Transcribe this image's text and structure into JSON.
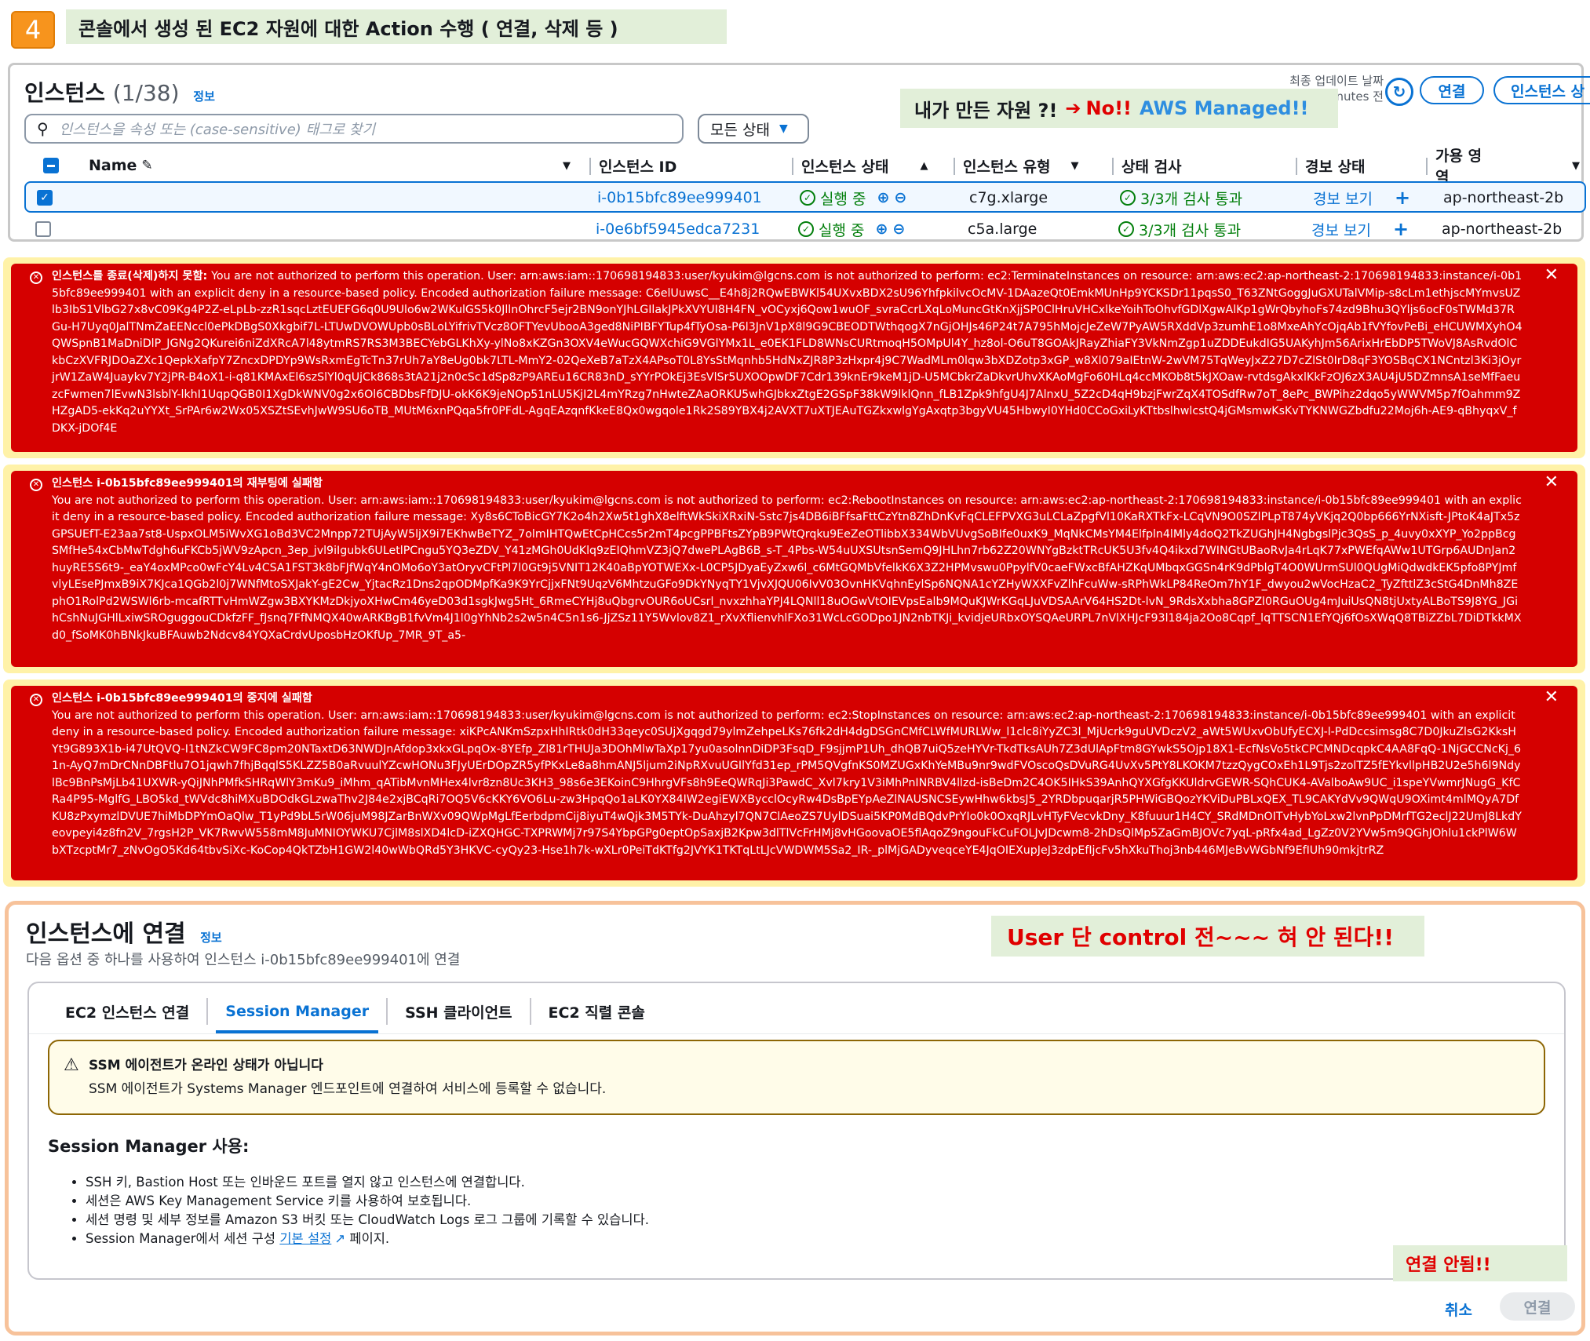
{
  "header": {
    "step": "4",
    "title": "콘솔에서 생성 된 EC2 자원에 대한 Action 수행 ( 연결, 삭제  등 )"
  },
  "instances": {
    "title": "인스턴스",
    "count": "(1/38)",
    "info": "정보",
    "updated_label": "최종 업데이트 날짜",
    "updated_value": "inutes 전",
    "connect_btn": "연결",
    "instance_state_btn": "인스턴스 상",
    "search_placeholder": "인스턴스을 속성 또는 (case-sensitive) 태그로 찾기",
    "status_filter": "모든 상태",
    "columns": [
      "Name",
      "인스턴스 ID",
      "인스턴스 상태",
      "인스턴스 유형",
      "상태 검사",
      "경보 상태",
      "가용 영역"
    ],
    "rows": [
      {
        "selected": true,
        "name": "",
        "id": "i-0b15bfc89ee999401",
        "state": "실행 중",
        "type": "c7g.xlarge",
        "check": "3/3개 검사 통과",
        "alarm": "경보 보기",
        "az": "ap-northeast-2b"
      },
      {
        "selected": false,
        "name": "",
        "id": "i-0e6bf5945edca7231",
        "state": "실행 중",
        "type": "c5a.large",
        "check": "3/3개 검사 통과",
        "alarm": "경보 보기",
        "az": "ap-northeast-2b"
      }
    ]
  },
  "managed_note": {
    "prefix": "내가 만든 자원 ?!",
    "arrow": "➔",
    "no": "No!!",
    "aws": "AWS Managed!!"
  },
  "errors": [
    {
      "title": "인스턴스를 종료(삭제)하지 못함: ",
      "body": "You are not authorized to perform this operation. User: arn:aws:iam::170698194833:user/kyukim@lgcns.com is not authorized to perform: ec2:TerminateInstances on resource: arn:aws:ec2:ap-northeast-2:170698194833:instance/i-0b15bfc89ee999401 with an explicit deny in a resource-based policy. Encoded authorization failure message: C6elUuwsC__E4h8j2RQwEBWKl54UXvxBDX2sU96YhfpkilvcOcMV-1DAazeQt0EmkMUnHp9YCKSDr11pqsS0_T63ZNtGoggJuGXUTalVMip-s8cLm1ethjscMYmvsUZlb3IbS1VlbG27x8vC09Kg4P2Z-eLpLb-zzR1sqcLztEUEFG6q0U9Ulo6w2WKulGS5k0JllnOhrcF5ejr2BN9onYJhLGIlakJPkXVYUI8H4FN_vOCyxj6Qow1wuOF_svraCcrLXqLoMuncGtKnXjjSP0ClHruVHCxlkeYoihToOhvfGDlXgwAlKp1gWrQbyhoFs74zd9Bhu3QYljs6ocF0sTWMd37RGu-H7Uyq0JalTNmZaEENccl0ePkDBgS0Xkgbif7L-LTUwDVOWUpb0sBLoLYifrivTVcz8OFTYevUbooA3ged8NiPIBFYTup4fTyOsa-P6l3JnV1pX8l9G9CBEODTWthqogX7nGjOHJs46P24t7A795hMojcJeZeW7PyAW5RXddVp3zumhE1o8MxeAhYcOjqAb1fVYfovPeBi_eHCUWMXyhO4QWSpnB1MaDniDlP_JGNg2QKurei6niZdXRcA7l48ytmRS7RS3M3BECYebGLKhXy-ylNo8xKZGn3OXV4eWucGQWXchiG9VGlYMx1L_e0EK1FLD8WNsCURtmoqH5OMpUl4Y_hz8ol-O6uT8GOAkJRayZhiaFY3VkNmZgp1uZDDEukdIG5UAKyhJm56ArixHrEbDP5TWoVJ8AsRvdOlCkbCzXVFRJDOaZXc1QepkXafpY7ZncxDPDYp9WsRxmEgTcTn37rUh7aY8eUg0bk7LTL-MmY2-02QeXeB7aTzX4APsoT0L8YsStMqnhb5HdNxZJR8P3zHxpr4j9C7WadMLm0lqw3bXDZotp3xGP_w8Xl079aIEtnW-2wVM75TqWeyJxZ27D7cZlSt0IrD8qF3YOSBqCX1NCntzl3Ki3jOyrjrW1ZaW4Juaykv7Y2jPR-B4oX1-i-q81KMAxEl6szSlYl0qUjCk868s3tA21j2n0cSc1dSp8zP9AREu16CR83nD_sYYrPOkEj3EsVlSr5UXOOpwDF7Cdr139knEr9keM1jD-U5MCbkrZaDkvrUhvXKAoMgFo60HLq4ccMKOb8t5kJXOaw-rvtdsgAkxlKkFzOJ6zX3AU4jU5DZmnsA1seMfFaeuzcFwmen7lEvwN3lsblY-lkhI1UqpQGB0I1XgDkWNV0g2x6Ol6CBDbsFfDJU-okK6K9jeNOp51nLU5KjI2L4mYRzg7nHwteZAaORKU5whGJbkxZtgE2GSpF38kW9lklQnn_fLB1Zpk9hfgU4J7AlnxU_5Z2cD4qH9bzjFwrZqX4TOSdfRw7oT_8ePc_BWPihz2dqo5yWWVM5p7fOahmm9ZHZgAD5-ekKq2uYYXt_SrPAr6w2Wx05XSZtSEvhJwW9SU6oTB_MUtM6xnPQqa5fr0PFdL-AgqEAzqnfKkeE8Qx0wgqole1Rk2S89YBX4j2AVXT7uXTJEAuTGZkxwlgYgAxqtp3bgyVU45HbwyI0YHd0CCoGxiLyKTtbslhwlcstQ4jGMsmwKsKvTYKNWGZbdfu22Moj6h-AE9-qBhyqxV_fDKX-jDOf4E"
    },
    {
      "title": "인스턴스 i-0b15bfc89ee999401의 재부팅에 실패함",
      "body": "You are not authorized to perform this operation. User: arn:aws:iam::170698194833:user/kyukim@lgcns.com is not authorized to perform: ec2:RebootInstances on resource: arn:aws:ec2:ap-northeast-2:170698194833:instance/i-0b15bfc89ee999401 with an explicit deny in a resource-based policy. Encoded authorization failure message: Xy8s6CToBicGY7K2o4h2Xw5t1ghX8elftWkSkiXRxiN-Sstc7js4DB6iBFfsaFttCzYtn8ZhDnKvFqCLEFPVXG3uLCLaZpgfVl10KaRXTkFx-LCqVN9O0SZlPLpT874yVKjq2Q0bp666YrNXisft-JPtoK4aJTx5zGPSUEfT-E23aa7st8-UspxOLM5iWvXG1oBd3VC2Mnpp72TUjAyW5ljX9i7EKhwBeTYZ_7olmIHTQwEtCpHCcs5r2mT4pcgPPBFtsZYpB9PWtQrqku9EeZeOTlibbX334WbVUvgSoBIfe0uxK9_MqNkCMsYM4Elfpln4lMly4doQ2TkZUGhJH4NgbgslPjc3QsS_p_4uvy0xXYP_Yo2ppBcgSMfHe54xCbMwTdgh6uFKCb5jWV9zApcn_3ep_jvl9iIgubk6ULetlPCngu5YQ3eZDV_Y41zMGh0UdKlq9zEIQhmVZ3jQ7dwePLAgB6B_s-T_4Pbs-W54uUXSUtsnSemQ9JHLhn7rb62Z20WNYgBzktTRcUK5U3fv4Q4ikxd7WINGtUBaoRvJa4rLqK77xPWEfqAWw1UTGrp6AUDnJan2huyRE5S6t9-_eaY4oxMPco0wFcY4Lv4CSA1FST3k8bFJfWqY4nOMo6oY3atOryvCFtPl7l0Gt9j5VNIT12K40aBpYOTWEXx-L0CP5JDyaEyZxw6l_c6MtGQMbVfelkK6X3Z2HPMvswu0PpylfV0caeFWxcBfAHZKqUMbqxGGSn4rK9dPblgT4O0WUrmSUl0QUgMiQdwdkEK5pfo8PYJmfvlyLEsePJmxB9iX7KJca1QGb2l0j7WNfMtoSXJakY-gE2Cw_YjtacRz1Dns2qpODMpfKa9K9YrCjjxFNt9UqzV6MhtzuGFo9DkYNyqTY1VjvXJQU06IvV03OvnHKVqhnEylSp6NQNA1cYZHyWXXFvZlhFcuWw-sRPhWkLP84ReOm7hY1F_dwyou2wVocHzaC2_TyZfttlZ3cStG4DnMh8ZEphO1RolPd2WSWl6rb-mcafRTTvHmWZgw3BXYKMzDkjyoXHwCm46yeD03d1sgkJwg5Ht_6RmeCYHj8uQbgrvOUR6oUCsrl_nvxzhhaYPJ4LQNll18uOGwVtOIEVpsEalb9MQuKJWrKGqLJuVDSAArV64HS2Dt-lvN_9RdsXxbha8GPZl0RGuOUg4mJuiUsQN8tjUxtyALBoTS9J8YG_JGihCshNuJGHlLxiwSROguggouCDkfzFF_fJsnq7FfNMQX40wARKBgB1fvVm4J1l0gYhNb2s2w5n4C5n1s6-JjZSz11Y5Wvlov8Z1_rXvXflienvhlFXo31WcLcGODpo1JN2nbTKJi_kvidjeURbxOYSQAeURPL7nVlXHJcF93l184ja2Oo8Cqpf_lqTTSCN1EfYQj6fOsXWqQ8TBiZZbL7DiDTkkMXd0_fSoMK0hBNkJkuBFAuwb2Ndcv84YQXaCrdvUposbHzOKfUp_7MR_9T_a5-"
    },
    {
      "title": "인스턴스 i-0b15bfc89ee999401의 중지에 실패함",
      "body": "You are not authorized to perform this operation. User: arn:aws:iam::170698194833:user/kyukim@lgcns.com is not authorized to perform: ec2:StopInstances on resource: arn:aws:ec2:ap-northeast-2:170698194833:instance/i-0b15bfc89ee999401 with an explicit deny in a resource-based policy. Encoded authorization failure message: xiKPcANKmSzpxHhIRtk0dH33qeyc0SUjXgqgd79ylmZehpeLKs76fk2dH4dgDSGnCMfCLWfMURLWw_l1clc8iYyZC3l_MjUcrk9guUVDczV2_aWt5WUxvObUfyECXJ-l-PdDccsimsg8C7D0JkuZlsG2KksHYt9G893X1b-i47UtQVQ-I1tNZkCW9FC8pm20NTaxtD63NWDJnAfdop3xkxGLpqOx-8YEfp_Zl81rTHUJa3DOhMlwTaXp17yu0asolnnDiDP3FsqD_F9sjjmP1Uh_dhQB7uiQ5zeHYVr-TkdTksAUh7Z3dUlApFtm8GYwkS5Ojp18X1-EcfNsVo5tkCPCMNDcqpkC4AA8FqQ-1NjGCCNcKj_61n-AyQ7mDrCNnDBFtlu7O1jqwh7fhjBqqlS5KLZZ5B0aRvuulYZcwHONu3FJyUErDOpZR5yfPKxLe8a8hmANJ5ljum2iNpRXvuUGIlYfd31ep_rPM5QVgfnKS0MZUGxKhYeMBu9nr9wdFVOscoQsDVuRG4UvXv5PtY8LKOKM7tzzQygCOxEh1L9Tjs2zolTZ5fEYkvllpHB2U2e5h6l9NdylBc9BnPsMjLb41UXWR-yQiJNhPMfkSHRqWlY3mKu9_iMhm_qATibMvnMHex4lvr8zn8Uc3KH3_98s6e3EKoinC9HhrgVFs8h9EeQWRqJi3PawdC_Xvl7kry1V3iMhPnINRBV4llzd-isBeDm2C4OK5IHkS39AnhQYXGfgKKUldrvGEWR-SQhCUK4-AValboAw9UC_i1speYVwmrJNugG_KfCRa4P95-MglfG_LBO5kd_tWVdc8hiMXuBDOdkGLzwaThv2J84e2xjBCqRi7OQ5V6cKKY6VO6Lu-zw3HpqQo1aLK0YX84IW2egiEWXBycclOcyRw4DsBpEYpAeZlNAUSNCSEywHhw6kbsJ5_2YRDbpuqarjR5PHWiGBQozYKViDuPBLxQEX_TL9CAKYdVv9QWqU9OXimt4mlMQyA7DfKU8zPxymzlDVUE7hiMbDPYmOaQlw_T1yPd9bL5rW06juM98JZarBnWXv09QWpMgLfEerbdpmCij8iyuT4wQjk3M5TYk-DuAhzyl7QN7ClAeoZS7UylDSuai5KP0MdBQdvPrYIo0k0OxqRJLvHTyFVecvkDny_K8fuuur1H4CY_SRdMDnOITvHybYoLxw2lvnPpDMrfTG2eclJ22UmJ8LkdYeovpeyi4z8fn2V_7rgsH2P_VK7RwvW558mM8JuMNIOYWKU7CjlM8slXD4lcD-iZXQHGC-TXPRWMj7r97S4YbpGPg0eptOpSaxjB2Kpw3dlTlVcFrHMj8vHGoovaOE5flAqoZ9ngouFkCuFOLJvJDcwm8-2hDsQlMp5ZaGmBJOVc7yqL-pRfx4ad_LgZz0V2YVw5m9QGhJOhlu1ckPlW6WbXTzcptMr7_zNvOgO5Kd64tbvSiXc-KoCop4QkTZbH1GW2l40wWbQRd5Y3HKVC-cyQy23-Hse1h7k-wXLr0PeiTdKTfg2JVYK1TKTqLtLJcVWDWM5Sa2_IR-_plMjGADyveqceYE4JqOIEXupJeJ3zdpEfIjcFv5hXkuThoj3nb446MJeBvWGbNf9EfIUh90mkjtrRZ"
    }
  ],
  "connect": {
    "title": "인스턴스에 연결",
    "info": "정보",
    "subtitle": "다음 옵션 중 하나를 사용하여 인스턴스 i-0b15bfc89ee999401에 연결",
    "user_note": "User 단 control 전~~~ 혀 안 된다!!",
    "tabs": [
      "EC2 인스턴스 연결",
      "Session Manager",
      "SSH 클라이언트",
      "EC2 직렬 콘솔"
    ],
    "active_tab": 1,
    "warning_title": "SSM 에이전트가 온라인 상태가 아닙니다",
    "warning_text": "SSM 에이전트가 Systems Manager 엔드포인트에 연결하여 서비스에 등록할 수 없습니다.",
    "sm_heading": "Session Manager 사용:",
    "bullets": [
      "SSH 키, Bastion Host 또는 인바운드 포트를 열지 않고 인스턴스에 연결합니다.",
      "세션은 AWS Key Management Service 키를 사용하여 보호됩니다.",
      "세션 명령 및 세부 정보를 Amazon S3 버킷 또는 CloudWatch Logs 로그 그룹에 기록할 수 있습니다."
    ],
    "last_bullet_pre": "Session Manager에서 세션 구성 ",
    "last_bullet_link": "기본 설정",
    "last_bullet_post": " 페이지.",
    "fail_note": "연결 안됨!!",
    "cancel": "취소",
    "connect": "연결"
  },
  "icons": {
    "search": "search-icon",
    "refresh": "refresh-icon",
    "check_ok": "check-circle-icon",
    "zoom": "zoom-icons",
    "error": "error-circle-icon",
    "close": "close-icon",
    "warning": "warning-icon",
    "external": "external-link-icon"
  },
  "colors": {
    "error_bg": "#d50000",
    "error_border": "#fff2a8",
    "link": "#0972d3",
    "ok": "#037f0c",
    "note_bg": "#e2efd9",
    "note_red": "#e00000",
    "step_orange": "#f7941d"
  }
}
